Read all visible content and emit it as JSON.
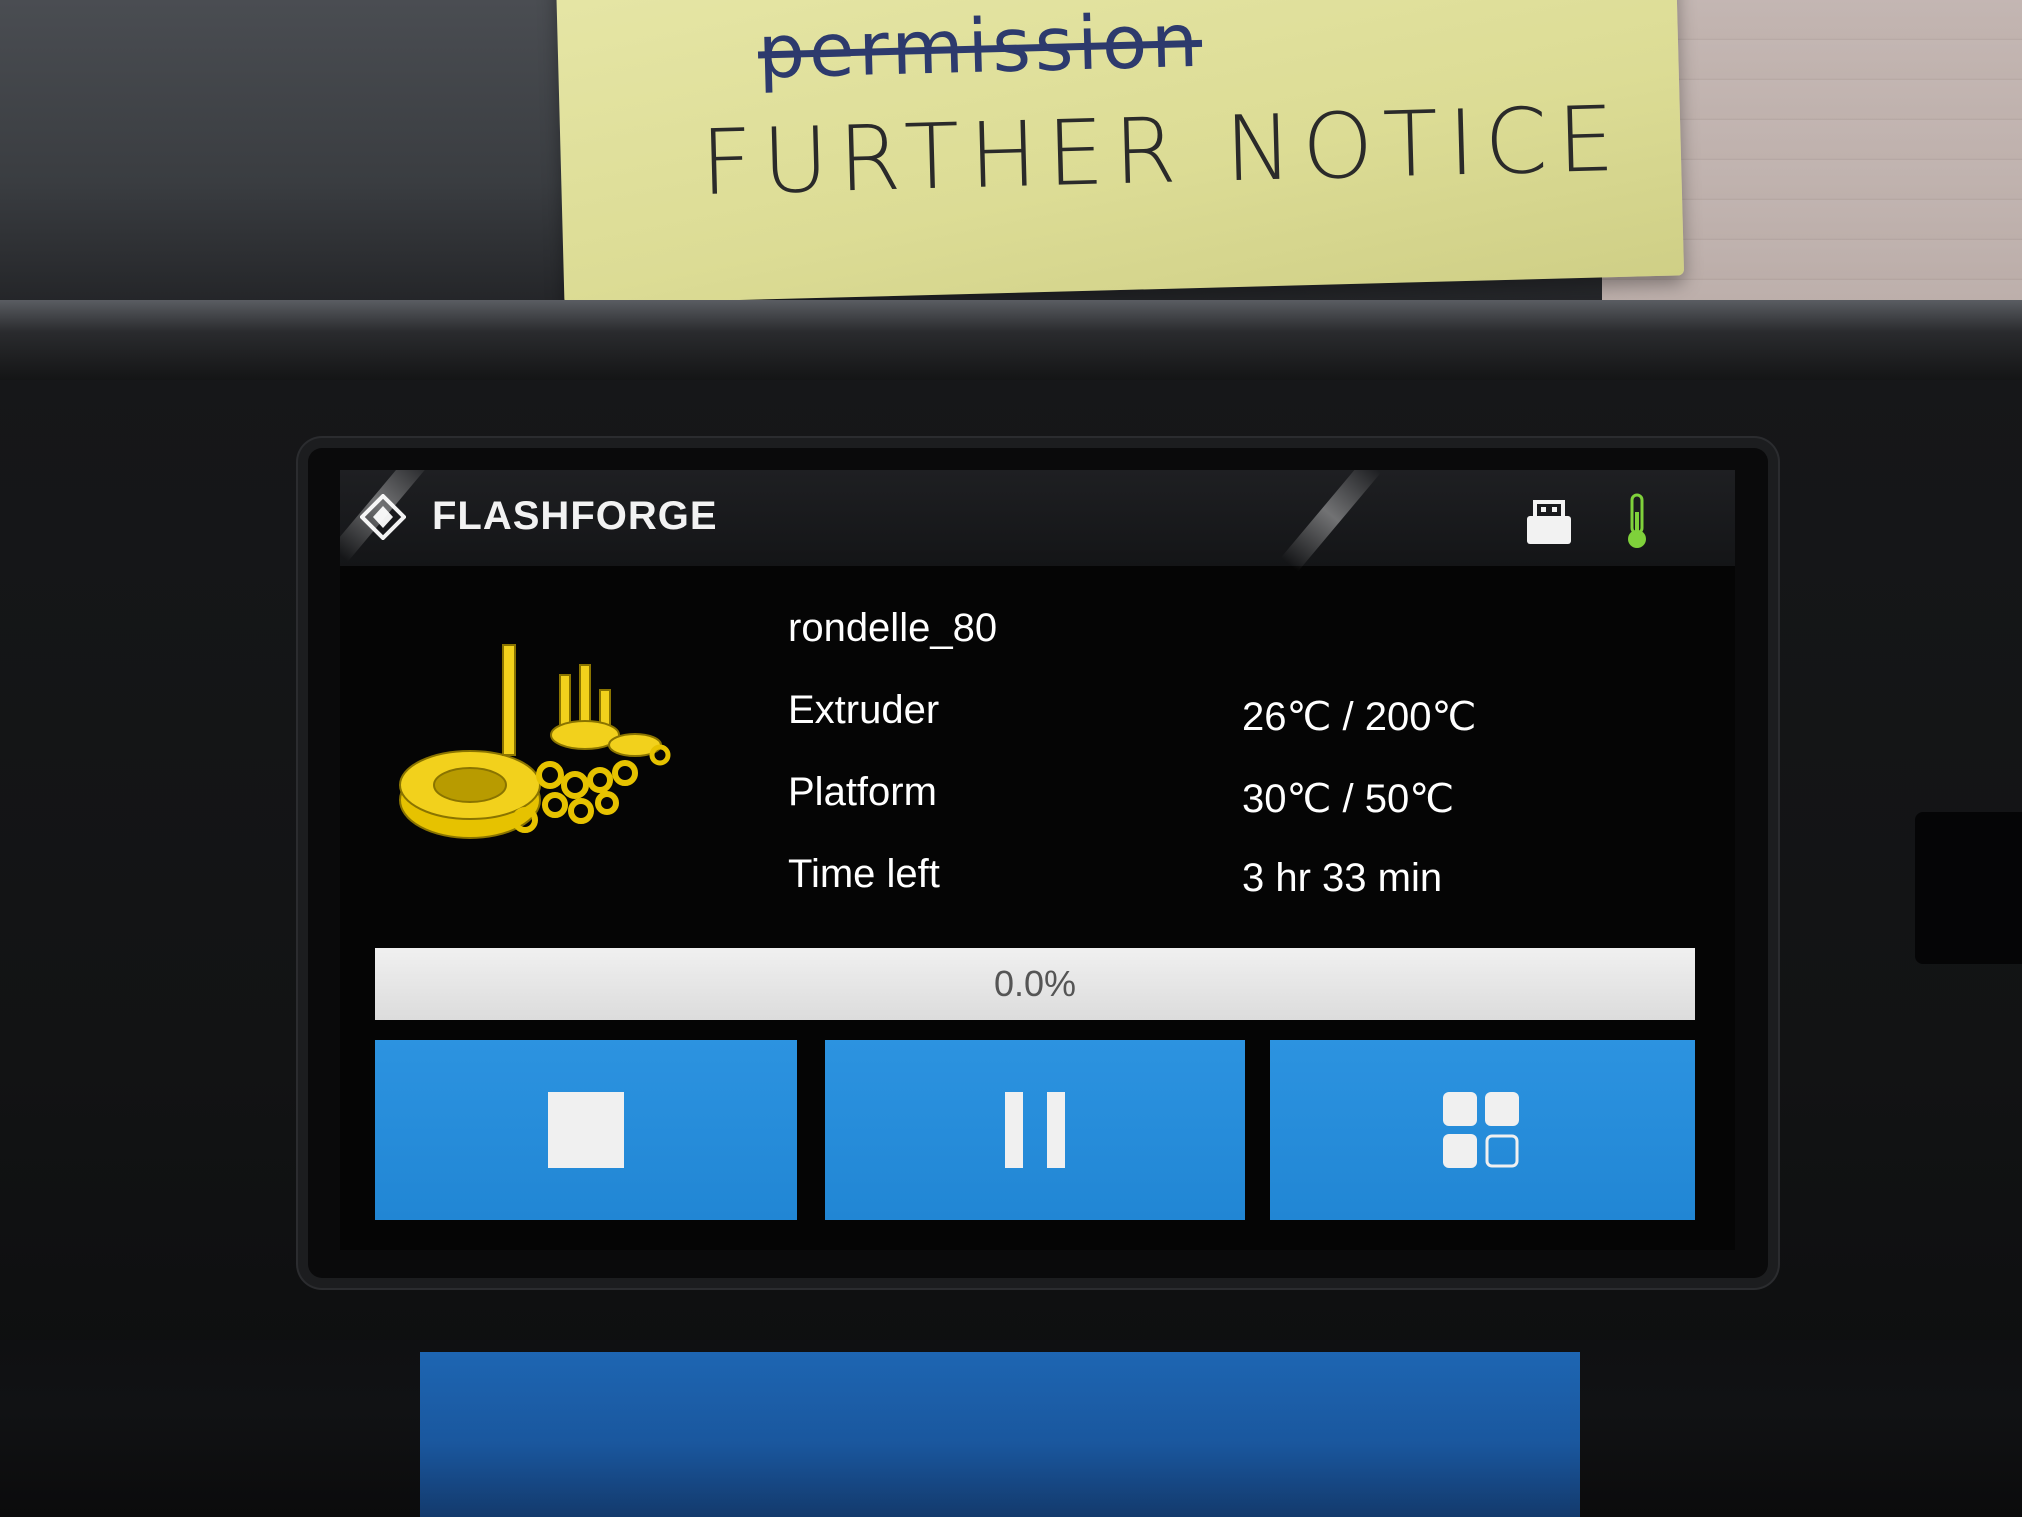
{
  "note": {
    "line1": "permission",
    "line2": "FURTHER NOTICE"
  },
  "header": {
    "brand": "FLASHFORGE",
    "usb_icon": "usb-drive-icon",
    "thermo_icon": "thermometer-icon",
    "thermo_color": "#7fd13b"
  },
  "job": {
    "file_name": "rondelle_80",
    "extruder_label": "Extruder",
    "extruder_value": "26℃ / 200℃",
    "platform_label": "Platform",
    "platform_value": "30℃ / 50℃",
    "time_left_label": "Time left",
    "time_left_value": "3 hr 33 min"
  },
  "progress": {
    "text": "0.0%",
    "fraction": 0.0
  },
  "buttons": {
    "stop_icon": "stop-icon",
    "pause_icon": "pause-icon",
    "menu_icon": "apps-grid-icon",
    "color": "#2a90dc"
  }
}
